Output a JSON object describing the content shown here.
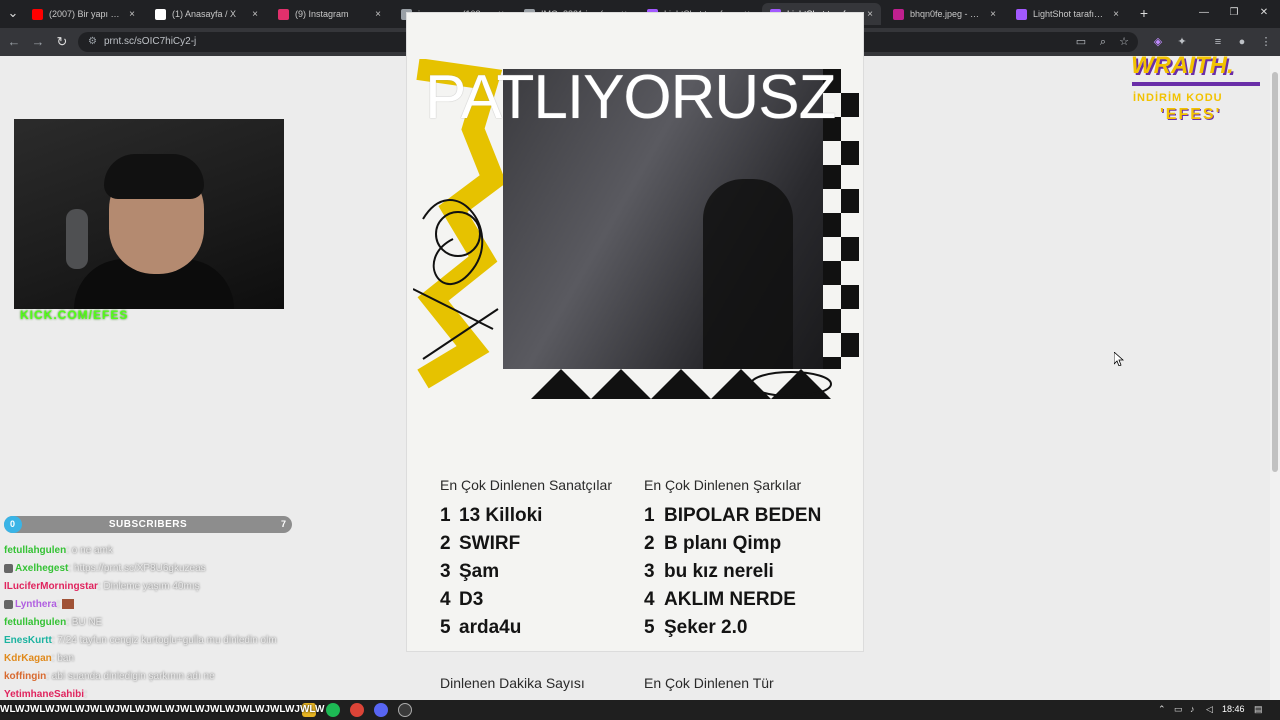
{
  "browser": {
    "tabs": [
      {
        "title": "(2007) Bir yapı var | A",
        "favicon_color": "#ff0000",
        "active": false
      },
      {
        "title": "(1) Anasayfa / X",
        "favicon_color": "#ffffff",
        "active": false
      },
      {
        "title": "(9) Instagram",
        "favicon_color": "#e1306c",
        "active": false
      },
      {
        "title": "image.png (1080×19",
        "favicon_color": "#9aa0a6",
        "active": false
      },
      {
        "title": "IMG_8831.jpg (1080",
        "favicon_color": "#9aa0a6",
        "active": false
      },
      {
        "title": "LightShot tarafından",
        "favicon_color": "#a259ff",
        "active": false
      },
      {
        "title": "LightShot tarafından",
        "favicon_color": "#a259ff",
        "active": true
      },
      {
        "title": "bhqn0fe.jpeg - Hızlı",
        "favicon_color": "#c0208f",
        "active": false
      },
      {
        "title": "LightShot tarafından",
        "favicon_color": "#a259ff",
        "active": false
      }
    ],
    "new_tab_glyph": "+",
    "close_glyph": "×",
    "url": "prnt.sc/sOIC7hiCy2-j",
    "window_controls": [
      "—",
      "❐",
      "✕"
    ]
  },
  "receipt": {
    "overlay_title": "PATLIYORUSZ",
    "artists_header": "En Çok Dinlenen Sanatçılar",
    "songs_header": "En Çok Dinlenen Şarkılar",
    "artists": [
      "13 Killoki",
      "SWIRF",
      "Şam",
      "D3",
      "arda4u"
    ],
    "songs": [
      "BIPOLAR BEDEN",
      "B planı Qimp",
      "bu kız nereli",
      "AKLIM NERDE",
      "Şeker 2.0"
    ],
    "ranks": [
      "1",
      "2",
      "3",
      "4",
      "5"
    ],
    "minutes_header": "Dinlenen Dakika Sayısı",
    "genre_header": "En Çok Dinlenen Tür"
  },
  "stream": {
    "kick_url": "KICK.COM/EFES",
    "brand": "WRAITH.",
    "discount_label": "İNDİRİM KODU",
    "discount_code": "'EFES'",
    "subscribers": {
      "label": "SUBSCRIBERS",
      "current": "0",
      "goal": "7",
      "progress_fraction": 0.0
    }
  },
  "chat": [
    {
      "user": "fetullahgulen",
      "color": "#35c235",
      "msg": ": o ne amk",
      "badge": false,
      "emote": false
    },
    {
      "user": "Axelhegest",
      "color": "#35c235",
      "msg": ": https://prnt.sc/XP8U6gkuzeas",
      "badge": true,
      "emote": false
    },
    {
      "user": "ILuciferMorningstar",
      "color": "#e0245e",
      "msg": ": Dinleme yaşım 40mış",
      "badge": false,
      "emote": false
    },
    {
      "user": "Lynthera",
      "color": "#b05fe0",
      "msg": ":",
      "badge": true,
      "emote": true
    },
    {
      "user": "fetullahgulen",
      "color": "#35c235",
      "msg": ": BU NE",
      "badge": false,
      "emote": false
    },
    {
      "user": "EnesKurtt",
      "color": "#1cb3a0",
      "msg": ": 7/24 tayfun cengiz kurtoglu+gulla mu dinledin olm",
      "badge": false,
      "emote": false
    },
    {
      "user": "KdrKagan",
      "color": "#e08a1c",
      "msg": ": ban",
      "badge": false,
      "emote": false
    },
    {
      "user": "koffingin",
      "color": "#d86a30",
      "msg": ": abi suanda dinledigin şarkının adı ne",
      "badge": false,
      "emote": false
    },
    {
      "user": "YetimhaneSahibi",
      "color": "#e0245e",
      "msg": ":",
      "badge": false,
      "emote": false
    }
  ],
  "marquee": "WLWJWLWJWLWJWLWJWLWJWLWJWLWJWLWJWLWJWLWJWLW",
  "taskbar": {
    "time": "18:46"
  }
}
